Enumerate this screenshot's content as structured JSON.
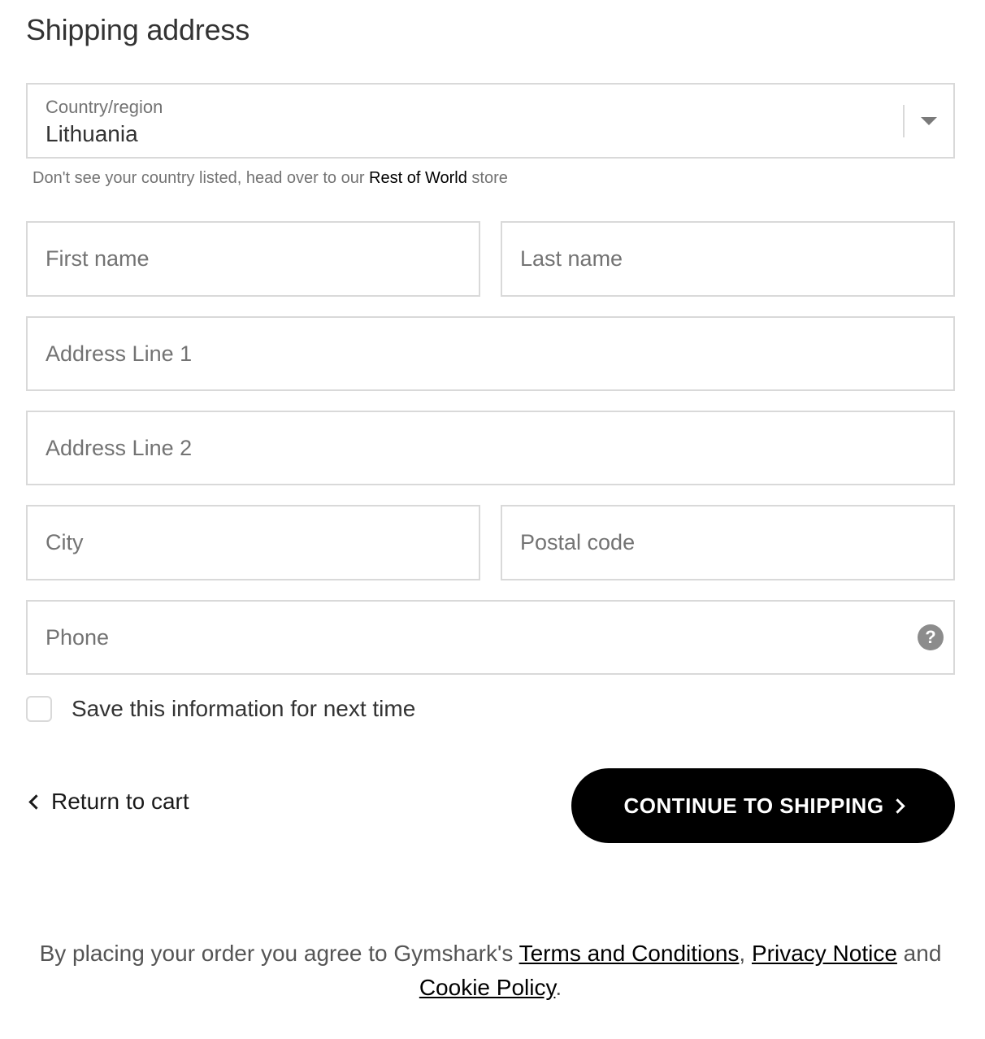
{
  "section_title": "Shipping address",
  "country": {
    "label": "Country/region",
    "value": "Lithuania"
  },
  "helper": {
    "prefix": "Don't see your country listed, head over to our ",
    "link": "Rest of World",
    "suffix": " store"
  },
  "fields": {
    "first_name": "First name",
    "last_name": "Last name",
    "address1": "Address Line 1",
    "address2": "Address Line 2",
    "city": "City",
    "postal": "Postal code",
    "phone": "Phone"
  },
  "help_icon": "?",
  "save_info": "Save this information for next time",
  "return_label": "Return to cart",
  "continue_label": "CONTINUE TO SHIPPING",
  "legal": {
    "prefix": "By placing your order you agree to Gymshark's ",
    "terms": "Terms and Conditions",
    "comma": ", ",
    "privacy": "Privacy Notice",
    "and": " and",
    "cookie": "Cookie Policy",
    "period": "."
  },
  "colors": {
    "button_bg": "#000000",
    "border": "#d9d9d9",
    "placeholder": "#737373"
  }
}
